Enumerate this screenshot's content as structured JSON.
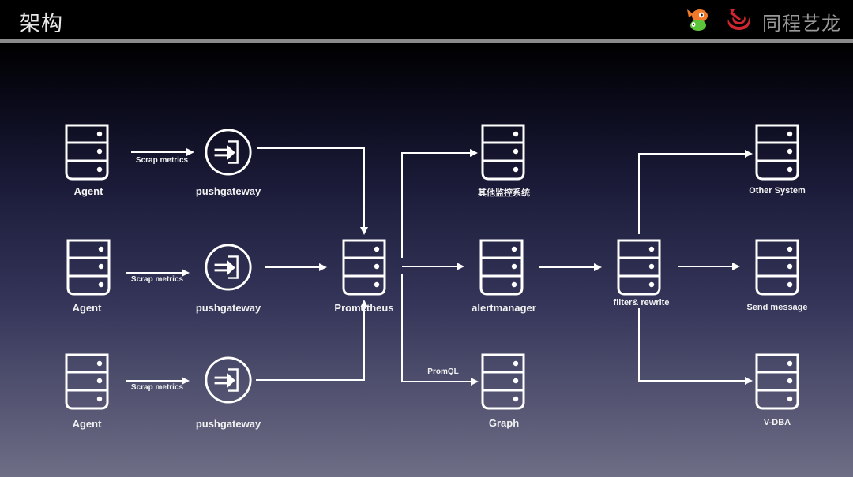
{
  "header": {
    "title": "架构",
    "brand_name": "同程艺龙",
    "brand_icons": [
      "clownfish-logo-icon",
      "elong-swirl-logo-icon"
    ],
    "colors": {
      "brand_red": "#d0262f",
      "fish_orange": "#f07a2a",
      "fish_green": "#5cc43a",
      "brand_text": "#9a9a9a"
    }
  },
  "diagram": {
    "nodes": {
      "agent1": {
        "label": "Agent",
        "icon": "server-icon"
      },
      "agent2": {
        "label": "Agent",
        "icon": "server-icon"
      },
      "agent3": {
        "label": "Agent",
        "icon": "server-icon"
      },
      "push1": {
        "label": "pushgateway",
        "icon": "push-gateway-icon"
      },
      "push2": {
        "label": "pushgateway",
        "icon": "push-gateway-icon"
      },
      "push3": {
        "label": "pushgateway",
        "icon": "push-gateway-icon"
      },
      "prometheus": {
        "label": "Prometheus",
        "icon": "server-icon"
      },
      "other_monitor": {
        "label": "其他监控系统",
        "icon": "server-icon"
      },
      "alertmanager": {
        "label": "alertmanager",
        "icon": "server-icon"
      },
      "graph": {
        "label": "Graph",
        "icon": "server-icon"
      },
      "filter": {
        "label": "filter& rewrite",
        "icon": "server-icon"
      },
      "other_system": {
        "label": "Other System",
        "icon": "server-icon"
      },
      "send_message": {
        "label": "Send message",
        "icon": "server-icon"
      },
      "vdba": {
        "label": "V-DBA",
        "icon": "server-icon"
      }
    },
    "edges": [
      {
        "from": "agent1",
        "to": "push1",
        "label": "Scrap metrics"
      },
      {
        "from": "agent2",
        "to": "push2",
        "label": "Scrap metrics"
      },
      {
        "from": "agent3",
        "to": "push3",
        "label": "Scrap metrics"
      },
      {
        "from": "push1",
        "to": "prometheus",
        "label": ""
      },
      {
        "from": "push2",
        "to": "prometheus",
        "label": ""
      },
      {
        "from": "push3",
        "to": "prometheus",
        "label": ""
      },
      {
        "from": "prometheus",
        "to": "other_monitor",
        "label": ""
      },
      {
        "from": "prometheus",
        "to": "alertmanager",
        "label": ""
      },
      {
        "from": "prometheus",
        "to": "graph",
        "label": "PromQL"
      },
      {
        "from": "alertmanager",
        "to": "filter",
        "label": ""
      },
      {
        "from": "filter",
        "to": "other_system",
        "label": ""
      },
      {
        "from": "filter",
        "to": "send_message",
        "label": ""
      },
      {
        "from": "filter",
        "to": "vdba",
        "label": ""
      }
    ]
  }
}
